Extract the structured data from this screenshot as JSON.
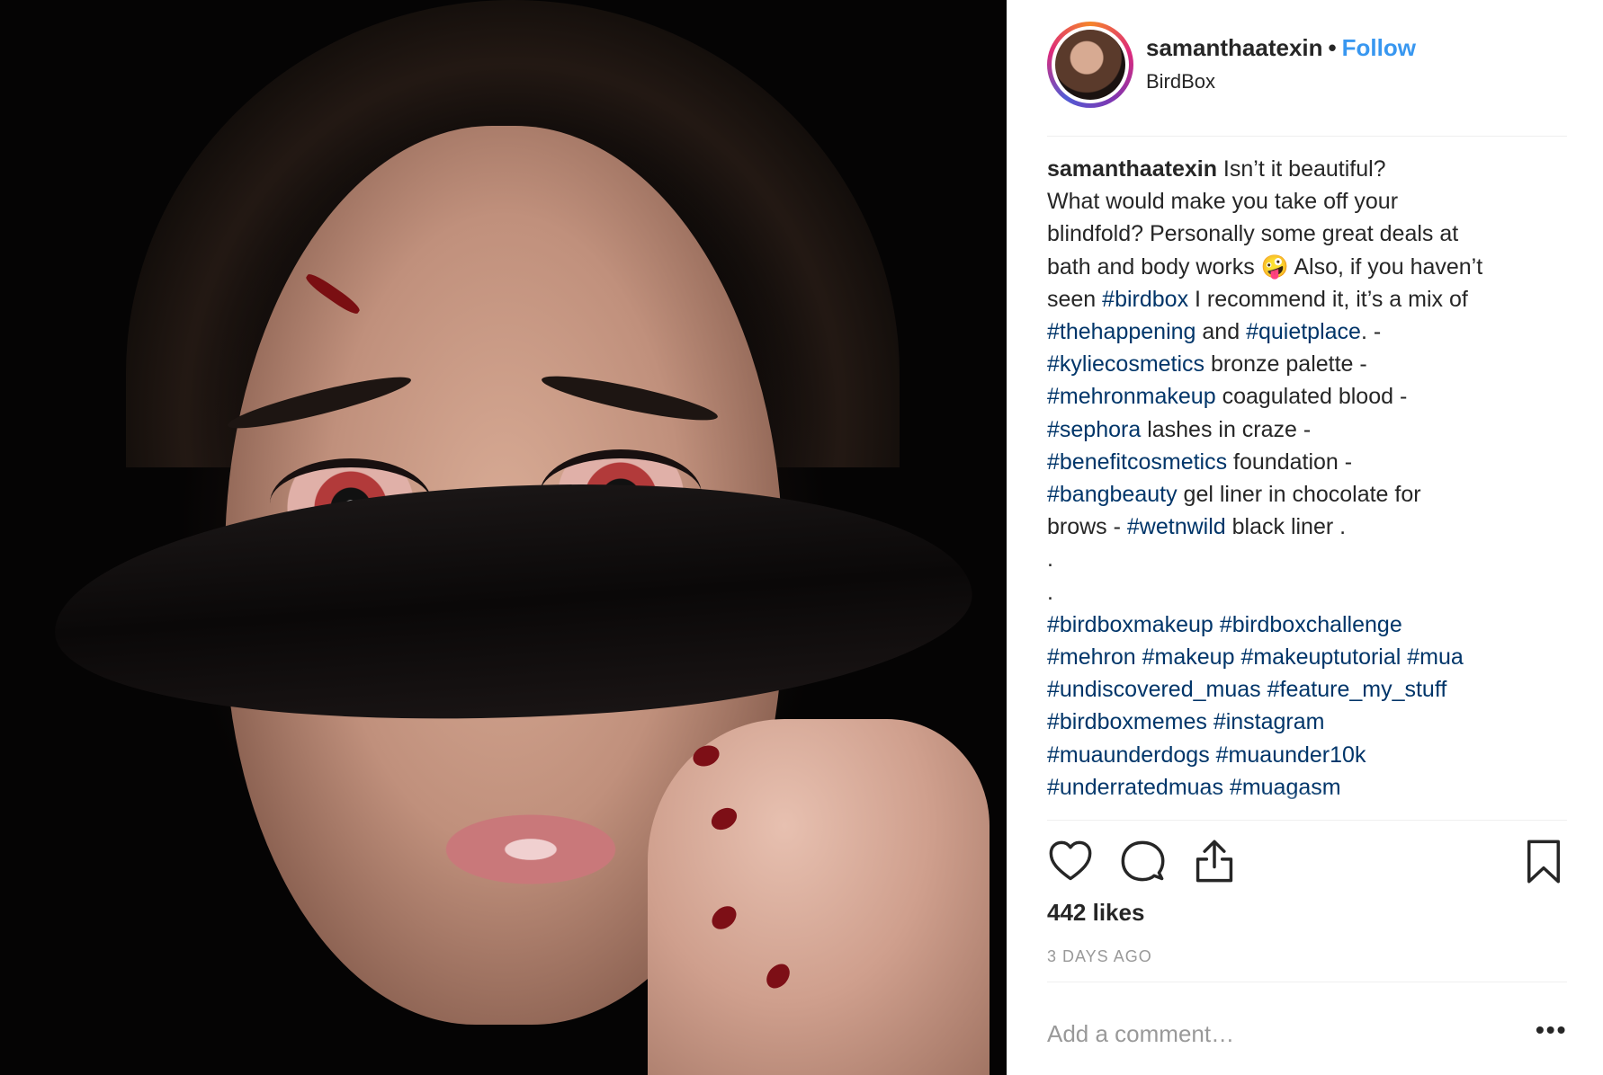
{
  "post": {
    "username": "samanthaatexin",
    "separator": "•",
    "follow_label": "Follow",
    "location": "BirdBox"
  },
  "caption": {
    "username": "samanthaatexin",
    "lines": [
      [
        {
          "t": "Isn’t it beautiful?"
        }
      ],
      [
        {
          "t": "What would make you take off your"
        }
      ],
      [
        {
          "t": "blindfold? Personally some great deals at"
        }
      ],
      [
        {
          "t": "bath and body works 🤪  Also, if you haven’t"
        }
      ],
      [
        {
          "t": "seen "
        },
        {
          "t": "#birdbox",
          "tag": true
        },
        {
          "t": " I recommend it, it’s a mix of"
        }
      ],
      [
        {
          "t": "#thehappening",
          "tag": true
        },
        {
          "t": " and "
        },
        {
          "t": "#quietplace",
          "tag": true
        },
        {
          "t": ". -"
        }
      ],
      [
        {
          "t": "#kyliecosmetics",
          "tag": true
        },
        {
          "t": " bronze palette -"
        }
      ],
      [
        {
          "t": "#mehronmakeup",
          "tag": true
        },
        {
          "t": " coagulated blood -"
        }
      ],
      [
        {
          "t": "#sephora",
          "tag": true
        },
        {
          "t": " lashes in craze -"
        }
      ],
      [
        {
          "t": "#benefitcosmetics",
          "tag": true
        },
        {
          "t": " foundation -"
        }
      ],
      [
        {
          "t": "#bangbeauty",
          "tag": true
        },
        {
          "t": " gel liner in chocolate for"
        }
      ],
      [
        {
          "t": "brows - "
        },
        {
          "t": "#wetnwild",
          "tag": true
        },
        {
          "t": " black liner ."
        }
      ],
      [
        {
          "t": "."
        }
      ],
      [
        {
          "t": "."
        }
      ],
      [
        {
          "t": "#birdboxmakeup",
          "tag": true
        },
        {
          "t": " "
        },
        {
          "t": "#birdboxchallenge",
          "tag": true
        }
      ],
      [
        {
          "t": "#mehron",
          "tag": true
        },
        {
          "t": " "
        },
        {
          "t": "#makeup",
          "tag": true
        },
        {
          "t": " "
        },
        {
          "t": "#makeuptutorial",
          "tag": true
        },
        {
          "t": " "
        },
        {
          "t": "#mua",
          "tag": true
        }
      ],
      [
        {
          "t": "#undiscovered_muas",
          "tag": true
        },
        {
          "t": " "
        },
        {
          "t": "#feature_my_stuff",
          "tag": true
        }
      ],
      [
        {
          "t": "#birdboxmemes",
          "tag": true
        },
        {
          "t": " "
        },
        {
          "t": "#instagram",
          "tag": true
        }
      ],
      [
        {
          "t": "#muaunderdogs",
          "tag": true
        },
        {
          "t": " "
        },
        {
          "t": "#muaunder10k",
          "tag": true
        }
      ],
      [
        {
          "t": "#underratedmuas",
          "tag": true
        },
        {
          "t": " "
        },
        {
          "t": "#muagasm",
          "tag": true
        }
      ]
    ]
  },
  "actions": {
    "icons": [
      "heart-icon",
      "comment-icon",
      "share-icon",
      "bookmark-icon"
    ]
  },
  "likes_label": "442 likes",
  "timestamp": "3 DAYS AGO",
  "comment": {
    "placeholder": "Add a comment…",
    "more_label": "•••"
  },
  "colors": {
    "follow": "#3897f0",
    "hashtag": "#003569",
    "text": "#262626",
    "muted": "#999999"
  }
}
